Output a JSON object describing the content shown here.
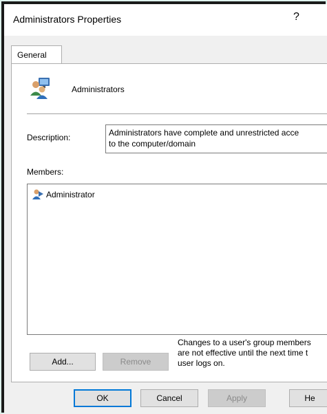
{
  "window": {
    "title": "Administrators Properties",
    "help_glyph": "?"
  },
  "tabs": [
    {
      "label": "General",
      "active": true
    }
  ],
  "group": {
    "name": "Administrators"
  },
  "description": {
    "label": "Description:",
    "line1": "Administrators have complete and unrestricted acce",
    "line2": "to the computer/domain"
  },
  "members": {
    "label": "Members:",
    "items": [
      {
        "name": "Administrator"
      }
    ]
  },
  "buttons": {
    "add": "Add...",
    "remove": "Remove",
    "ok": "OK",
    "cancel": "Cancel",
    "apply": "Apply",
    "help": "He"
  },
  "note": {
    "line1": "Changes to a user's group members",
    "line2": "are not effective until the next time t",
    "line3": "user logs on."
  },
  "colors": {
    "accent": "#0078d7",
    "background_outer": "#dff3ee"
  }
}
